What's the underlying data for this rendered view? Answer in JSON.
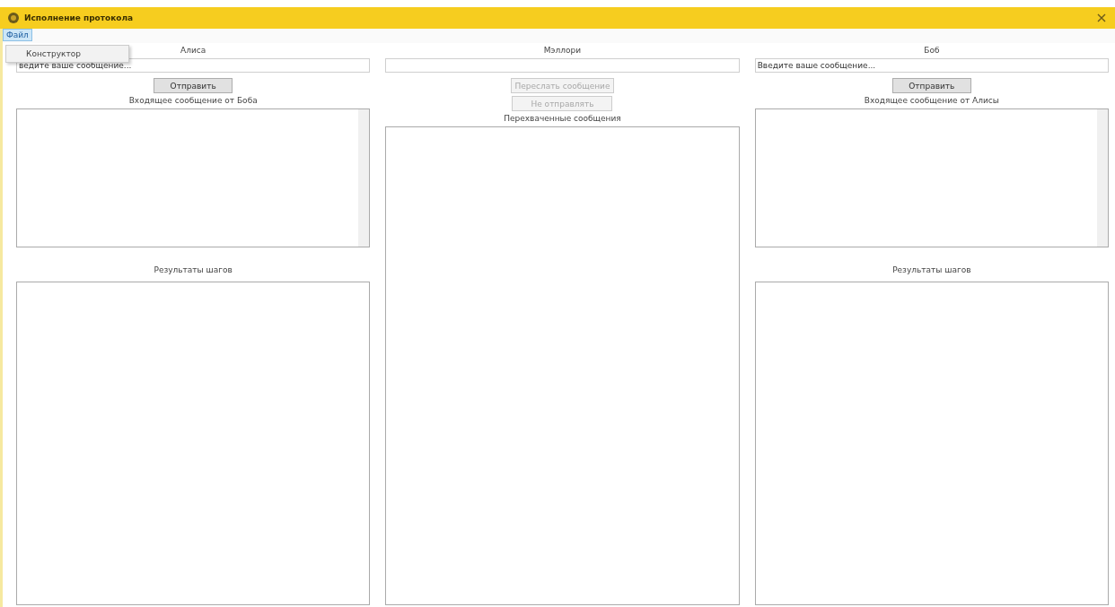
{
  "window": {
    "title": "Исполнение протокола"
  },
  "menu": [
    {
      "label": "Файл",
      "expanded": true,
      "items": [
        "Конструктор"
      ]
    }
  ],
  "columns": [
    {
      "name": "Алиса",
      "input": {
        "value": "ведите ваше сообщение..."
      },
      "buttons": [
        {
          "label": "Отправить",
          "disabled": false
        }
      ],
      "inbox_label": "Входящее сообщение от Боба",
      "results_label": "Результаты шагов"
    },
    {
      "name": "Мэллори",
      "buttons": [
        {
          "label": "Переслать сообщение",
          "disabled": true
        },
        {
          "label": "Не отправлять",
          "disabled": true
        }
      ],
      "inbox_label": "Перехваченные сообщения"
    },
    {
      "name": "Боб",
      "input": {
        "value": "Введите ваше сообщение..."
      },
      "buttons": [
        {
          "label": "Отправить",
          "disabled": false
        }
      ],
      "inbox_label": "Входящее сообщение от Алисы",
      "results_label": "Результаты шагов"
    }
  ]
}
